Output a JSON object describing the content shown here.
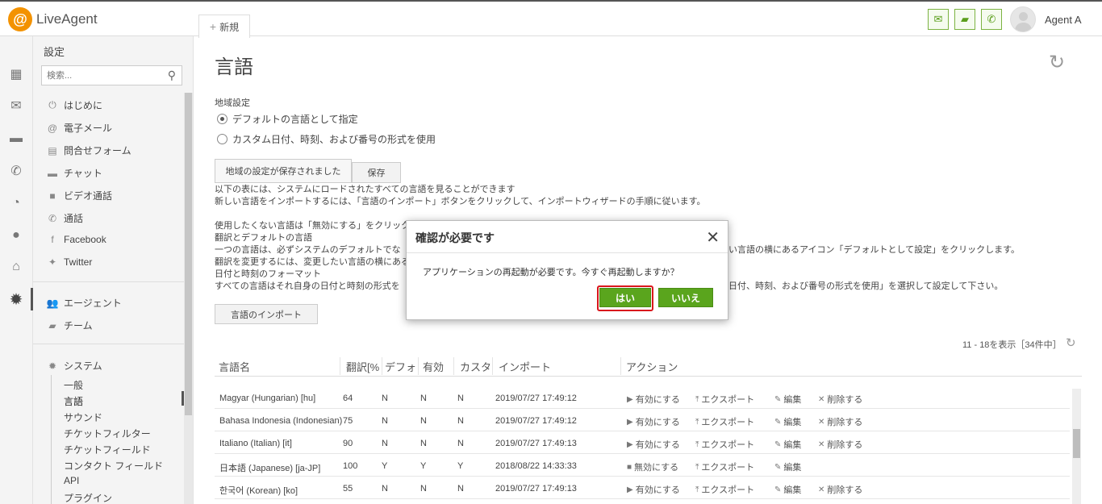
{
  "app": {
    "logo_mark": "@",
    "logo_text": "LiveAgent"
  },
  "header": {
    "new_tab_label": "新規",
    "agent_name": "Agent A",
    "icons": [
      "mail-icon",
      "chat-icon",
      "phone-icon"
    ]
  },
  "rail": [
    "dashboard-icon",
    "mail-icon",
    "chat-icon",
    "phone-icon",
    "reports-icon",
    "contacts-icon",
    "knowledgebase-icon",
    "settings-icon"
  ],
  "sidebar": {
    "title": "設定",
    "search_placeholder": "検索...",
    "items": [
      {
        "label": "はじめに",
        "icon": "power-icon"
      },
      {
        "label": "電子メール",
        "icon": "at-icon"
      },
      {
        "label": "問合せフォーム",
        "icon": "form-icon"
      },
      {
        "label": "チャット",
        "icon": "chat-icon"
      },
      {
        "label": "ビデオ通話",
        "icon": "video-icon"
      },
      {
        "label": "通話",
        "icon": "phone-icon"
      },
      {
        "label": "Facebook",
        "icon": "facebook-icon"
      },
      {
        "label": "Twitter",
        "icon": "twitter-icon"
      }
    ],
    "group2": [
      {
        "label": "エージェント",
        "icon": "agents-icon"
      },
      {
        "label": "チーム",
        "icon": "folder-icon"
      }
    ],
    "system": {
      "label": "システム",
      "children": [
        "一般",
        "言語",
        "サウンド",
        "チケットフィルター",
        "チケットフィールド",
        "コンタクト フィールド",
        "API",
        "プラグイン"
      ]
    }
  },
  "main": {
    "title": "言語",
    "regional_label": "地域設定",
    "radio_default": "デフォルトの言語として指定",
    "radio_custom": "カスタム日付、時刻、および番号の形式を使用",
    "saved_button": "地域の設定が保存されました",
    "save_button": "保存",
    "para": [
      "以下の表には、システムにロードされたすべての言語を見ることができます",
      "新しい言語をインポートするには、「言語のインポート」ボタンをクリックして、インポートウィザードの手順に従います。",
      "",
      "使用したくない言語は「無効にする」をクリック",
      "翻訳とデフォルトの言語",
      "一つの言語は、必ずシステムのデフォルトでな",
      "翻訳を変更するには、変更したい言語の横にある",
      "日付と時刻のフォーマット",
      "すべての言語はそれ自身の日付と時刻の形式を"
    ],
    "para_right_1": "い言語の横にあるアイコン「デフォルトとして設定」をクリックします。",
    "para_right_2": "日付、時刻、および番号の形式を使用」を選択して設定して下さい。",
    "import_button": "言語のインポート",
    "pager": "11 - 18を表示［34件中］"
  },
  "table": {
    "headers": [
      "言語名",
      "翻訳[%",
      "デフォ",
      "有効",
      "カスタ",
      "インポート",
      "アクション"
    ],
    "rows": [
      {
        "name": "Magyar (Hungarian) [hu]",
        "pct": "64",
        "def": "N",
        "en": "N",
        "cust": "N",
        "imp": "2019/07/27 17:49:12",
        "toggle": "有効にする",
        "export": "エクスポート",
        "edit": "編集",
        "del": "削除する"
      },
      {
        "name": "Bahasa Indonesia (Indonesian)",
        "pct": "75",
        "def": "N",
        "en": "N",
        "cust": "N",
        "imp": "2019/07/27 17:49:12",
        "toggle": "有効にする",
        "export": "エクスポート",
        "edit": "編集",
        "del": "削除する"
      },
      {
        "name": "Italiano (Italian) [it]",
        "pct": "90",
        "def": "N",
        "en": "N",
        "cust": "N",
        "imp": "2019/07/27 17:49:13",
        "toggle": "有効にする",
        "export": "エクスポート",
        "edit": "編集",
        "del": "削除する"
      },
      {
        "name": "日本語 (Japanese) [ja-JP]",
        "pct": "100",
        "def": "Y",
        "en": "Y",
        "cust": "Y",
        "imp": "2018/08/22 14:33:33",
        "toggle": "無効にする",
        "export": "エクスポート",
        "edit": "編集",
        "del": ""
      },
      {
        "name": "한국어 (Korean) [ko]",
        "pct": "55",
        "def": "N",
        "en": "N",
        "cust": "N",
        "imp": "2019/07/27 17:49:13",
        "toggle": "有効にする",
        "export": "エクスポート",
        "edit": "編集",
        "del": "削除する"
      }
    ]
  },
  "modal": {
    "title": "確認が必要です",
    "message": "アプリケーションの再起動が必要です。今すぐ再起動しますか？",
    "yes": "はい",
    "no": "いいえ"
  },
  "colors": {
    "accent_green": "#5aa51d",
    "highlight_red": "#d9161c"
  }
}
